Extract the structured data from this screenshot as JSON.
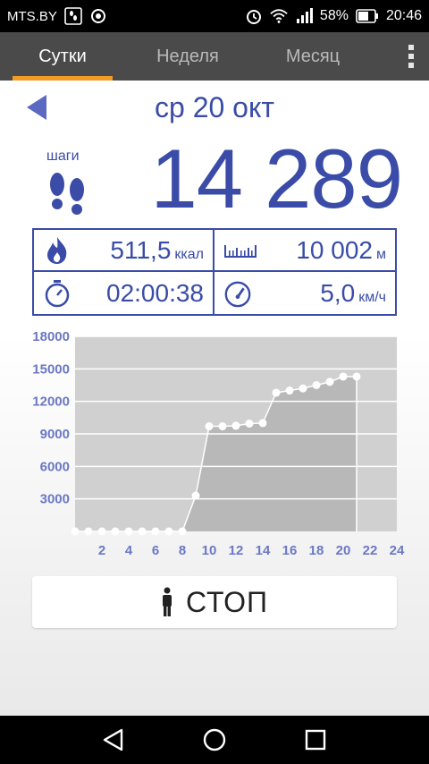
{
  "status_bar": {
    "carrier": "MTS.BY",
    "battery_percent": "58%",
    "time": "20:46",
    "icons": [
      "steps-notification-icon",
      "sync-notification-icon",
      "alarm-icon",
      "wifi-icon",
      "signal-icon",
      "battery-icon"
    ]
  },
  "tabs": [
    {
      "label": "Сутки",
      "active": true
    },
    {
      "label": "Неделя",
      "active": false
    },
    {
      "label": "Месяц",
      "active": false
    }
  ],
  "date": "ср 20 окт",
  "steps": {
    "label": "шаги",
    "value": "14 289"
  },
  "stats": {
    "calories": {
      "value": "511,5",
      "unit": "ккал",
      "icon": "flame-icon"
    },
    "distance": {
      "value": "10 002",
      "unit": "м",
      "icon": "ruler-icon"
    },
    "duration": {
      "value": "02:00:38",
      "unit": "",
      "icon": "stopwatch-icon"
    },
    "speed": {
      "value": "5,0",
      "unit": "км/ч",
      "icon": "speedometer-icon"
    }
  },
  "stop_button": {
    "label": "СТОП",
    "icon": "person-icon"
  },
  "colors": {
    "accent_blue": "#3a4ca8",
    "tab_bar": "#4a4a4a",
    "tab_indicator": "#f39c24",
    "chart_bg": "#d0d0d0",
    "chart_fill": "#b8b8b8"
  },
  "chart_data": {
    "type": "area",
    "x": [
      0,
      1,
      2,
      3,
      4,
      5,
      6,
      7,
      8,
      9,
      10,
      11,
      12,
      13,
      14,
      15,
      16,
      17,
      18,
      19,
      20,
      21
    ],
    "values": [
      0,
      0,
      0,
      0,
      0,
      0,
      0,
      0,
      0,
      3300,
      9700,
      9700,
      9750,
      9950,
      10000,
      12800,
      13000,
      13200,
      13500,
      13800,
      14289,
      14289
    ],
    "xticks": [
      2,
      4,
      6,
      8,
      10,
      12,
      14,
      16,
      18,
      20,
      22,
      24
    ],
    "yticks": [
      3000,
      6000,
      9000,
      12000,
      15000,
      18000
    ],
    "xlim": [
      0,
      24
    ],
    "ylim": [
      0,
      18000
    ],
    "grid": true
  }
}
